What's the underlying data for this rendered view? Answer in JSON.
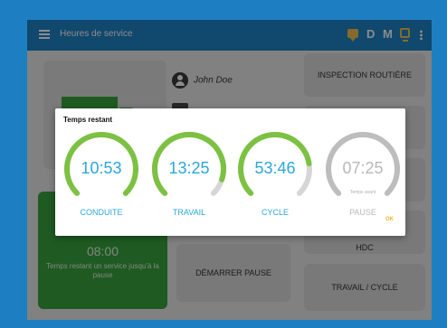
{
  "appbar": {
    "title": "Heures de service",
    "status_d": "D",
    "status_m": "M"
  },
  "driver": {
    "name": "John Doe"
  },
  "buttons": {
    "inspection": "INSPECTION ROUTIÈRE",
    "r4": "HDC",
    "pause": "DÉMARRER PAUSE",
    "travail_cycle": "TRAVAIL / CYCLE"
  },
  "status": {
    "time": "08:00",
    "label": "Temps restant un service jusqu'à la pause"
  },
  "dialog": {
    "title": "Temps restant",
    "ok": "OK",
    "gauges": [
      {
        "value": "10:53",
        "label": "CONDUITE",
        "fraction": 1.0,
        "color": "#7cc142"
      },
      {
        "value": "13:25",
        "label": "TRAVAIL",
        "fraction": 0.9,
        "color": "#7cc142"
      },
      {
        "value": "53:46",
        "label": "CYCLE",
        "fraction": 0.8,
        "color": "#7cc142"
      },
      {
        "value": "07:25",
        "label": "PAUSE",
        "sub": "Temps avant",
        "fraction": 1.0,
        "color": "#bdbdbd"
      }
    ]
  },
  "colors": {
    "primary": "#1f83c7",
    "accent_green": "#3aa53f",
    "gauge_text": "#2ba6dc",
    "ok": "#f2b632"
  }
}
